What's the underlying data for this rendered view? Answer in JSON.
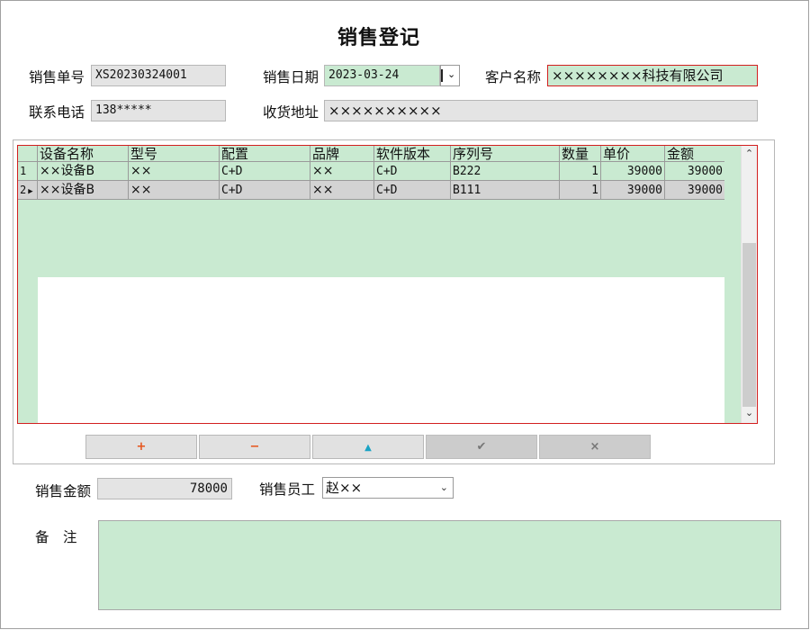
{
  "form": {
    "title": "销售登记",
    "order_no_label": "销售单号",
    "order_no_value": "XS20230324001",
    "date_label": "销售日期",
    "date_value": "2023-03-24",
    "customer_label": "客户名称",
    "customer_value": "××××××××科技有限公司",
    "phone_label": "联系电话",
    "phone_value": "138*****",
    "address_label": "收货地址",
    "address_value": "××××××××××"
  },
  "grid": {
    "columns": [
      "设备名称",
      "型号",
      "配置",
      "品牌",
      "软件版本",
      "序列号",
      "数量",
      "单价",
      "金额"
    ],
    "rows": [
      {
        "row_no": "1",
        "marker": "",
        "cells": [
          "××设备B",
          "××",
          "C+D",
          "××",
          "C+D",
          "B222",
          "1",
          "39000",
          "39000"
        ]
      },
      {
        "row_no": "2",
        "marker": "▶",
        "cells": [
          "××设备B",
          "××",
          "C+D",
          "××",
          "C+D",
          "B111",
          "1",
          "39000",
          "39000"
        ]
      }
    ]
  },
  "toolbar": {
    "add_label": "+",
    "remove_label": "−",
    "up_label": "▲",
    "confirm_label": "✔",
    "cancel_label": "×"
  },
  "footer": {
    "amount_label": "销售金额",
    "amount_value": "78000",
    "staff_label": "销售员工",
    "staff_value": "赵××",
    "remark_label": "备　注",
    "remark_value": ""
  },
  "colors": {
    "field_green": "#c9ead1",
    "required_border": "#d31f1f",
    "add_icon": "#e6541b",
    "remove_icon": "#e6541b",
    "up_icon": "#1aa3c4"
  }
}
